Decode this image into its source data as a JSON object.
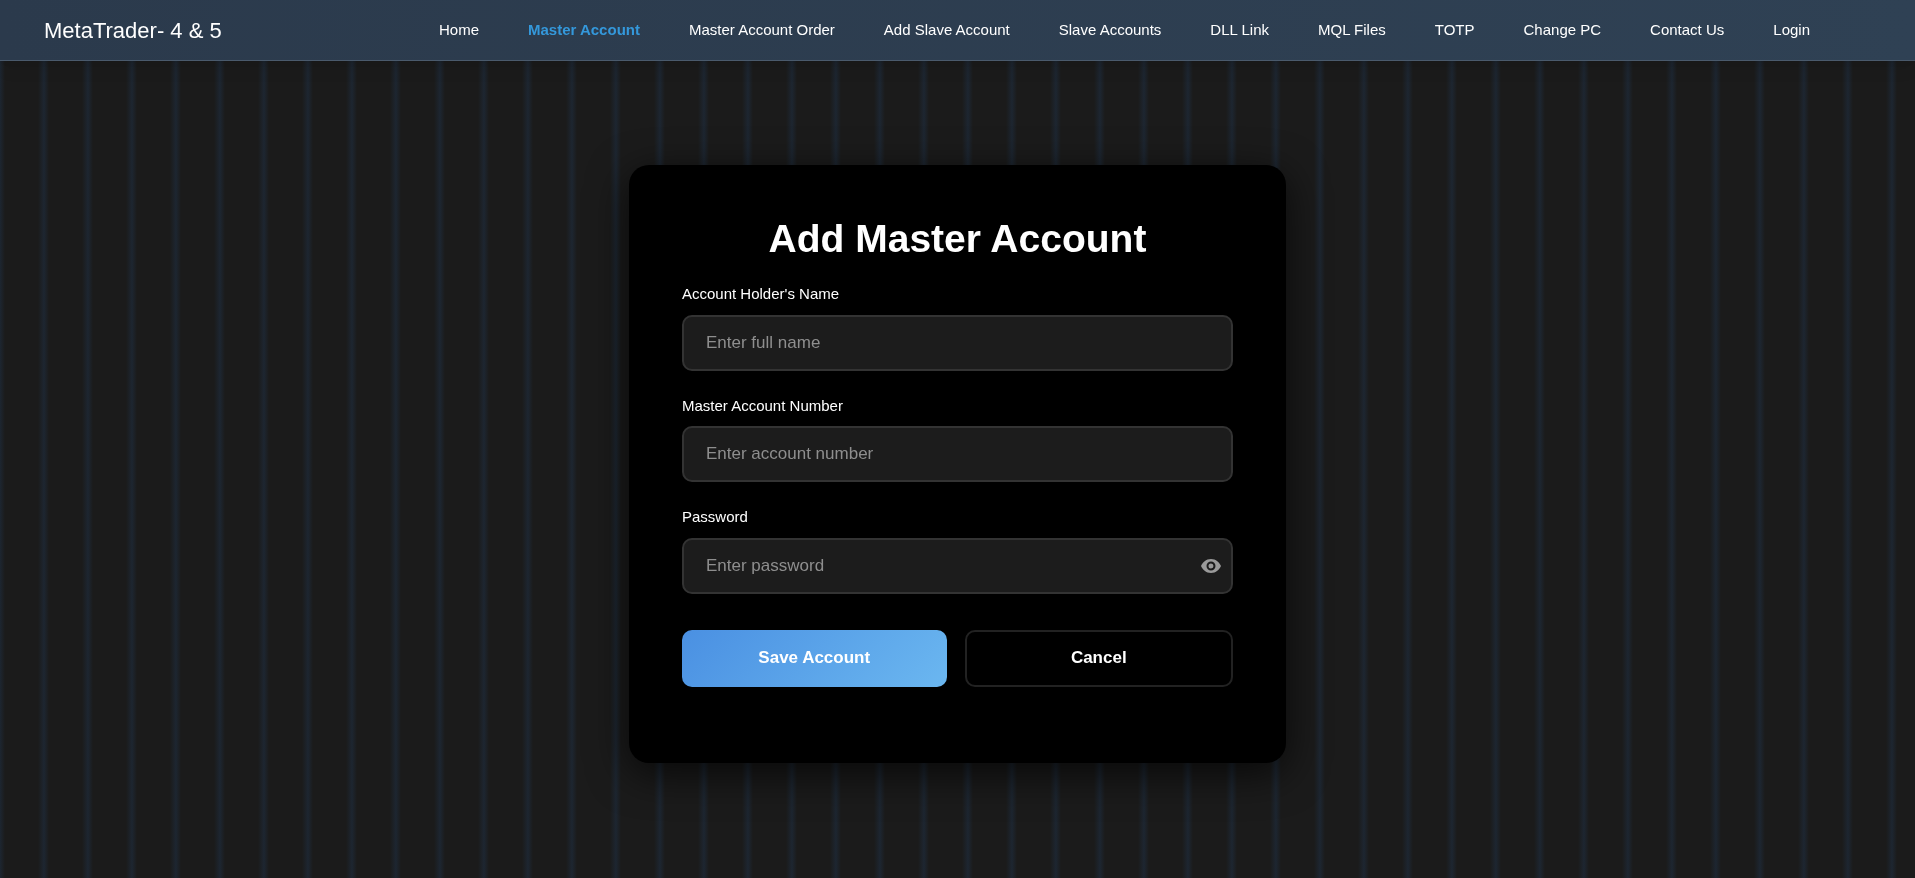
{
  "brand": "MetaTrader- 4 & 5",
  "nav": [
    {
      "label": "Home",
      "selected": false
    },
    {
      "label": "Master Account",
      "selected": true
    },
    {
      "label": "Master Account Order",
      "selected": false
    },
    {
      "label": "Add Slave Account",
      "selected": false
    },
    {
      "label": "Slave Accounts",
      "selected": false
    },
    {
      "label": "DLL Link",
      "selected": false
    },
    {
      "label": "MQL Files",
      "selected": false
    },
    {
      "label": "TOTP",
      "selected": false
    },
    {
      "label": "Change PC",
      "selected": false
    },
    {
      "label": "Contact Us",
      "selected": false
    },
    {
      "label": "Login",
      "selected": false
    }
  ],
  "form": {
    "title": "Add Master Account",
    "fields": [
      {
        "kind": "text",
        "label": "Account Holder's Name",
        "placeholder": "Enter full name"
      },
      {
        "kind": "text",
        "label": "Master Account Number",
        "placeholder": "Enter account number"
      },
      {
        "kind": "password",
        "label": "Password",
        "placeholder": "Enter password"
      }
    ],
    "buttons": [
      {
        "kind": "primary",
        "label": "Save Account"
      },
      {
        "kind": "secondary",
        "label": "Cancel"
      }
    ]
  }
}
